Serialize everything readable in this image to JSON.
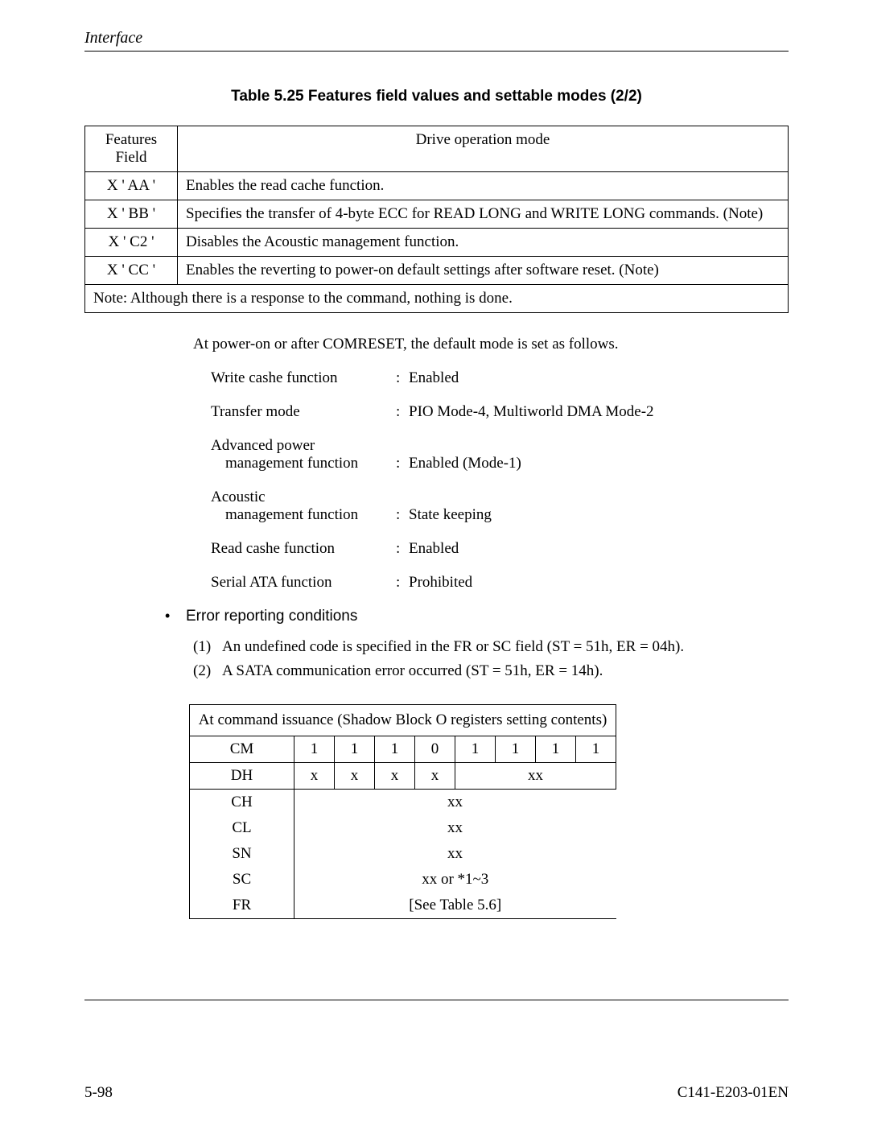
{
  "header": {
    "section": "Interface"
  },
  "table1": {
    "caption": "Table 5.25  Features field values and settable modes (2/2)",
    "col0": "Features Field",
    "col1": "Drive operation mode",
    "rows": [
      {
        "f": "X ' AA '",
        "d": "Enables the read cache function."
      },
      {
        "f": "X ' BB '",
        "d": "Specifies the transfer of 4-byte ECC for READ LONG and WRITE LONG commands. (Note)"
      },
      {
        "f": "X ' C2 '",
        "d": "Disables the Acoustic management function."
      },
      {
        "f": "X ' CC '",
        "d": "Enables the reverting to power-on default settings after software reset. (Note)"
      }
    ],
    "note": "Note:  Although there is a response to the command, nothing is done."
  },
  "intro": "At power-on or after COMRESET, the default mode is set as follows.",
  "modes": [
    {
      "label1": "Write cashe function",
      "label2": "",
      "value": "Enabled"
    },
    {
      "label1": "Transfer mode",
      "label2": "",
      "value": "PIO Mode-4, Multiworld DMA Mode-2"
    },
    {
      "label1": "Advanced power",
      "label2": "management function",
      "value": "Enabled (Mode-1)"
    },
    {
      "label1": "Acoustic",
      "label2": "management function",
      "value": "State keeping"
    },
    {
      "label1": "Read cashe function",
      "label2": "",
      "value": "Enabled"
    },
    {
      "label1": "Serial ATA function",
      "label2": "",
      "value": "Prohibited"
    }
  ],
  "errcond": {
    "title": "Error reporting conditions",
    "items": [
      {
        "n": "(1)",
        "t": "An undefined code is specified in the FR or SC field (ST = 51h, ER = 04h)."
      },
      {
        "n": "(2)",
        "t": "A SATA communication error occurred (ST = 51h, ER = 14h)."
      }
    ]
  },
  "regs": {
    "caption": "At command issuance (Shadow Block O registers setting contents)",
    "labels": {
      "CM": "CM",
      "DH": "DH",
      "CH": "CH",
      "CL": "CL",
      "SN": "SN",
      "SC": "SC",
      "FR": "FR"
    },
    "cm": [
      "1",
      "1",
      "1",
      "0",
      "1",
      "1",
      "1",
      "1"
    ],
    "dh_bits": [
      "x",
      "x",
      "x",
      "x"
    ],
    "dh_tail": "xx",
    "xx": "xx",
    "sc": "xx or  *1~3",
    "fr": "[See Table 5.6]"
  },
  "footer": {
    "left": "5-98",
    "right": "C141-E203-01EN"
  }
}
